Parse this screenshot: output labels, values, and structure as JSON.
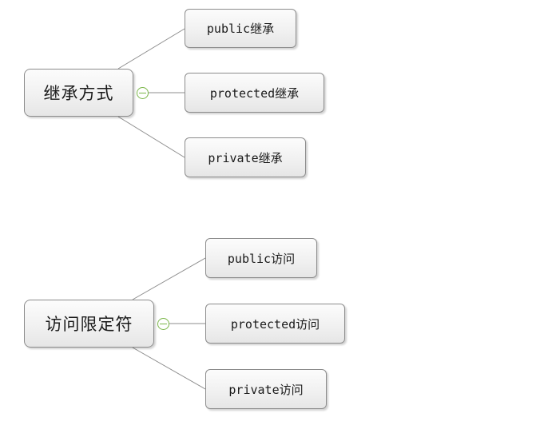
{
  "mind_maps": [
    {
      "root": "继承方式",
      "children": [
        "public继承",
        "protected继承",
        "private继承"
      ]
    },
    {
      "root": "访问限定符",
      "children": [
        "public访问",
        "protected访问",
        "private访问"
      ]
    }
  ]
}
